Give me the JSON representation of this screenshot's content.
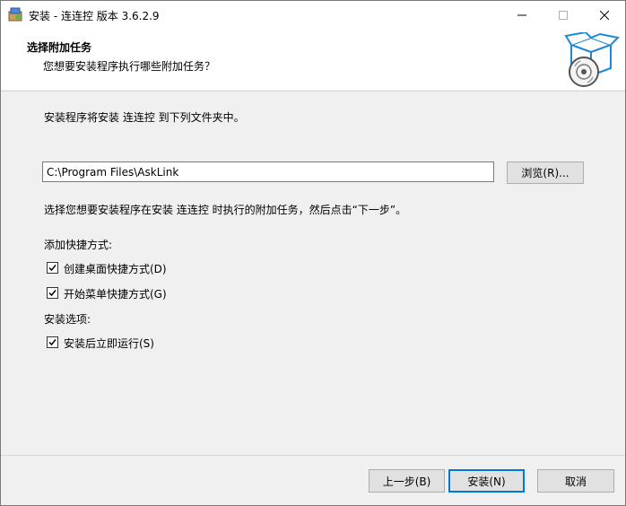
{
  "window": {
    "title": "安装 - 连连控 版本 3.6.2.9"
  },
  "header": {
    "title": "选择附加任务",
    "subtitle": "您想要安装程序执行哪些附加任务？"
  },
  "main": {
    "info": "安装程序将安装 连连控 到下列文件夹中。",
    "install_path": "C:\\Program Files\\AskLink",
    "browse_label": "浏览(R)...",
    "note": "选择您想要安装程序在安装 连连控 时执行的附加任务，然后点击“下一步”。",
    "shortcuts_group": "添加快捷方式:",
    "shortcut_options": [
      {
        "label": "创建桌面快捷方式(D)",
        "checked": true
      },
      {
        "label": "开始菜单快捷方式(G)",
        "checked": true
      }
    ],
    "install_options_group": "安装选项:",
    "install_options": [
      {
        "label": "安装后立即运行(S)",
        "checked": true
      }
    ]
  },
  "footer": {
    "back_label": "上一步(B)",
    "next_label": "安装(N)",
    "cancel_label": "取消"
  },
  "colors": {
    "accent": "#0078d7",
    "window_bg": "#f0f0f0",
    "header_bg": "#ffffff"
  },
  "icons": [
    "installer-app-icon",
    "minimize-icon",
    "maximize-icon",
    "close-icon",
    "setup-box-icon",
    "checkbox-checked-icon"
  ]
}
